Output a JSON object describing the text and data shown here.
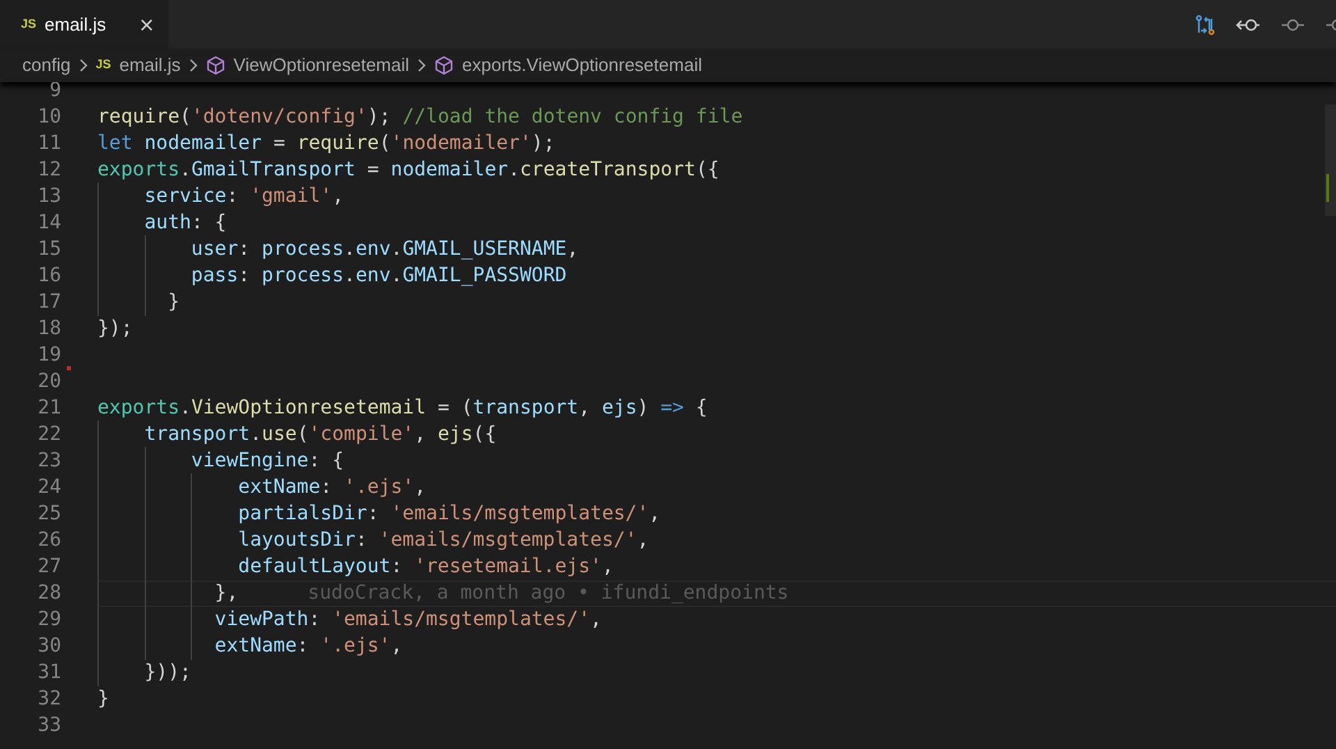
{
  "tabs": [
    {
      "icon_text": "JS",
      "label": "email.js",
      "close": "×",
      "selected": true
    }
  ],
  "breadcrumbs": [
    {
      "kind": "folder",
      "label": "config"
    },
    {
      "kind": "file",
      "icon_text": "JS",
      "label": "email.js"
    },
    {
      "kind": "symbol",
      "label": "ViewOptionresetemail"
    },
    {
      "kind": "symbol",
      "label": "exports.ViewOptionresetemail"
    }
  ],
  "code_lines": [
    {
      "number": "9"
    },
    {
      "number": "10",
      "tokens": [
        {
          "kind": "fn",
          "text": "require"
        },
        {
          "kind": "plain",
          "text": "("
        },
        {
          "kind": "str",
          "text": "'dotenv/config'"
        },
        {
          "kind": "plain",
          "text": "); "
        },
        {
          "kind": "comment",
          "text": "//load the dotenv config file"
        }
      ]
    },
    {
      "number": "11",
      "tokens": [
        {
          "kind": "keyword",
          "text": "let"
        },
        {
          "kind": "var",
          "text": " nodemailer"
        },
        {
          "kind": "plain",
          "text": " = "
        },
        {
          "kind": "fn",
          "text": "require"
        },
        {
          "kind": "plain",
          "text": "("
        },
        {
          "kind": "str",
          "text": "'nodemailer'"
        },
        {
          "kind": "plain",
          "text": ");"
        }
      ]
    },
    {
      "number": "12",
      "tokens": [
        {
          "kind": "obj",
          "text": "exports"
        },
        {
          "kind": "plain",
          "text": "."
        },
        {
          "kind": "var",
          "text": "GmailTransport"
        },
        {
          "kind": "plain",
          "text": " = "
        },
        {
          "kind": "var",
          "text": "nodemailer"
        },
        {
          "kind": "plain",
          "text": "."
        },
        {
          "kind": "fn",
          "text": "createTransport"
        },
        {
          "kind": "plain",
          "text": "({"
        }
      ]
    },
    {
      "number": "13",
      "tokens": [
        {
          "kind": "var",
          "text": "    service"
        },
        {
          "kind": "plain",
          "text": ": "
        },
        {
          "kind": "str",
          "text": "'gmail'"
        },
        {
          "kind": "plain",
          "text": ","
        }
      ]
    },
    {
      "number": "14",
      "tokens": [
        {
          "kind": "var",
          "text": "    auth"
        },
        {
          "kind": "plain",
          "text": ": {"
        }
      ]
    },
    {
      "number": "15",
      "tokens": [
        {
          "kind": "var",
          "text": "        user"
        },
        {
          "kind": "plain",
          "text": ": "
        },
        {
          "kind": "var",
          "text": "process"
        },
        {
          "kind": "plain",
          "text": "."
        },
        {
          "kind": "var",
          "text": "env"
        },
        {
          "kind": "plain",
          "text": "."
        },
        {
          "kind": "var",
          "text": "GMAIL_USERNAME"
        },
        {
          "kind": "plain",
          "text": ","
        }
      ]
    },
    {
      "number": "16",
      "tokens": [
        {
          "kind": "var",
          "text": "        pass"
        },
        {
          "kind": "plain",
          "text": ": "
        },
        {
          "kind": "var",
          "text": "process"
        },
        {
          "kind": "plain",
          "text": "."
        },
        {
          "kind": "var",
          "text": "env"
        },
        {
          "kind": "plain",
          "text": "."
        },
        {
          "kind": "var",
          "text": "GMAIL_PASSWORD"
        }
      ]
    },
    {
      "number": "17",
      "tokens": [
        {
          "kind": "plain",
          "text": "      }"
        }
      ]
    },
    {
      "number": "18",
      "tokens": [
        {
          "kind": "plain",
          "text": "});"
        }
      ]
    },
    {
      "number": "19"
    },
    {
      "number": "20"
    },
    {
      "number": "21",
      "tokens": [
        {
          "kind": "obj",
          "text": "exports"
        },
        {
          "kind": "plain",
          "text": "."
        },
        {
          "kind": "fn",
          "text": "ViewOptionresetemail"
        },
        {
          "kind": "plain",
          "text": " = ("
        },
        {
          "kind": "var",
          "text": "transport"
        },
        {
          "kind": "plain",
          "text": ", "
        },
        {
          "kind": "var",
          "text": "ejs"
        },
        {
          "kind": "plain",
          "text": ") "
        },
        {
          "kind": "keyword",
          "text": "=>"
        },
        {
          "kind": "plain",
          "text": " {"
        }
      ]
    },
    {
      "number": "22",
      "tokens": [
        {
          "kind": "var",
          "text": "    transport"
        },
        {
          "kind": "plain",
          "text": "."
        },
        {
          "kind": "fn",
          "text": "use"
        },
        {
          "kind": "plain",
          "text": "("
        },
        {
          "kind": "str",
          "text": "'compile'"
        },
        {
          "kind": "plain",
          "text": ", "
        },
        {
          "kind": "fn",
          "text": "ejs"
        },
        {
          "kind": "plain",
          "text": "({"
        }
      ]
    },
    {
      "number": "23",
      "tokens": [
        {
          "kind": "var",
          "text": "        viewEngine"
        },
        {
          "kind": "plain",
          "text": ": {"
        }
      ]
    },
    {
      "number": "24",
      "tokens": [
        {
          "kind": "var",
          "text": "            extName"
        },
        {
          "kind": "plain",
          "text": ": "
        },
        {
          "kind": "str",
          "text": "'.ejs'"
        },
        {
          "kind": "plain",
          "text": ","
        }
      ]
    },
    {
      "number": "25",
      "tokens": [
        {
          "kind": "var",
          "text": "            partialsDir"
        },
        {
          "kind": "plain",
          "text": ": "
        },
        {
          "kind": "str",
          "text": "'emails/msgtemplates/'"
        },
        {
          "kind": "plain",
          "text": ","
        }
      ]
    },
    {
      "number": "26",
      "tokens": [
        {
          "kind": "var",
          "text": "            layoutsDir"
        },
        {
          "kind": "plain",
          "text": ": "
        },
        {
          "kind": "str",
          "text": "'emails/msgtemplates/'"
        },
        {
          "kind": "plain",
          "text": ","
        }
      ]
    },
    {
      "number": "27",
      "tokens": [
        {
          "kind": "var",
          "text": "            defaultLayout"
        },
        {
          "kind": "plain",
          "text": ": "
        },
        {
          "kind": "str",
          "text": "'resetemail.ejs'"
        },
        {
          "kind": "plain",
          "text": ","
        }
      ]
    },
    {
      "number": "28",
      "current": true,
      "blame": "sudoCrack, a month ago • ifundi_endpoints",
      "tokens": [
        {
          "kind": "plain",
          "text": "          },"
        }
      ]
    },
    {
      "number": "29",
      "tokens": [
        {
          "kind": "var",
          "text": "          viewPath"
        },
        {
          "kind": "plain",
          "text": ": "
        },
        {
          "kind": "str",
          "text": "'emails/msgtemplates/'"
        },
        {
          "kind": "plain",
          "text": ","
        }
      ]
    },
    {
      "number": "30",
      "tokens": [
        {
          "kind": "var",
          "text": "          extName"
        },
        {
          "kind": "plain",
          "text": ": "
        },
        {
          "kind": "str",
          "text": "'.ejs'"
        },
        {
          "kind": "plain",
          "text": ","
        }
      ]
    },
    {
      "number": "31",
      "tokens": [
        {
          "kind": "plain",
          "text": "    }));"
        }
      ]
    },
    {
      "number": "32",
      "tokens": [
        {
          "kind": "plain",
          "text": "}"
        }
      ]
    },
    {
      "number": "33"
    }
  ]
}
